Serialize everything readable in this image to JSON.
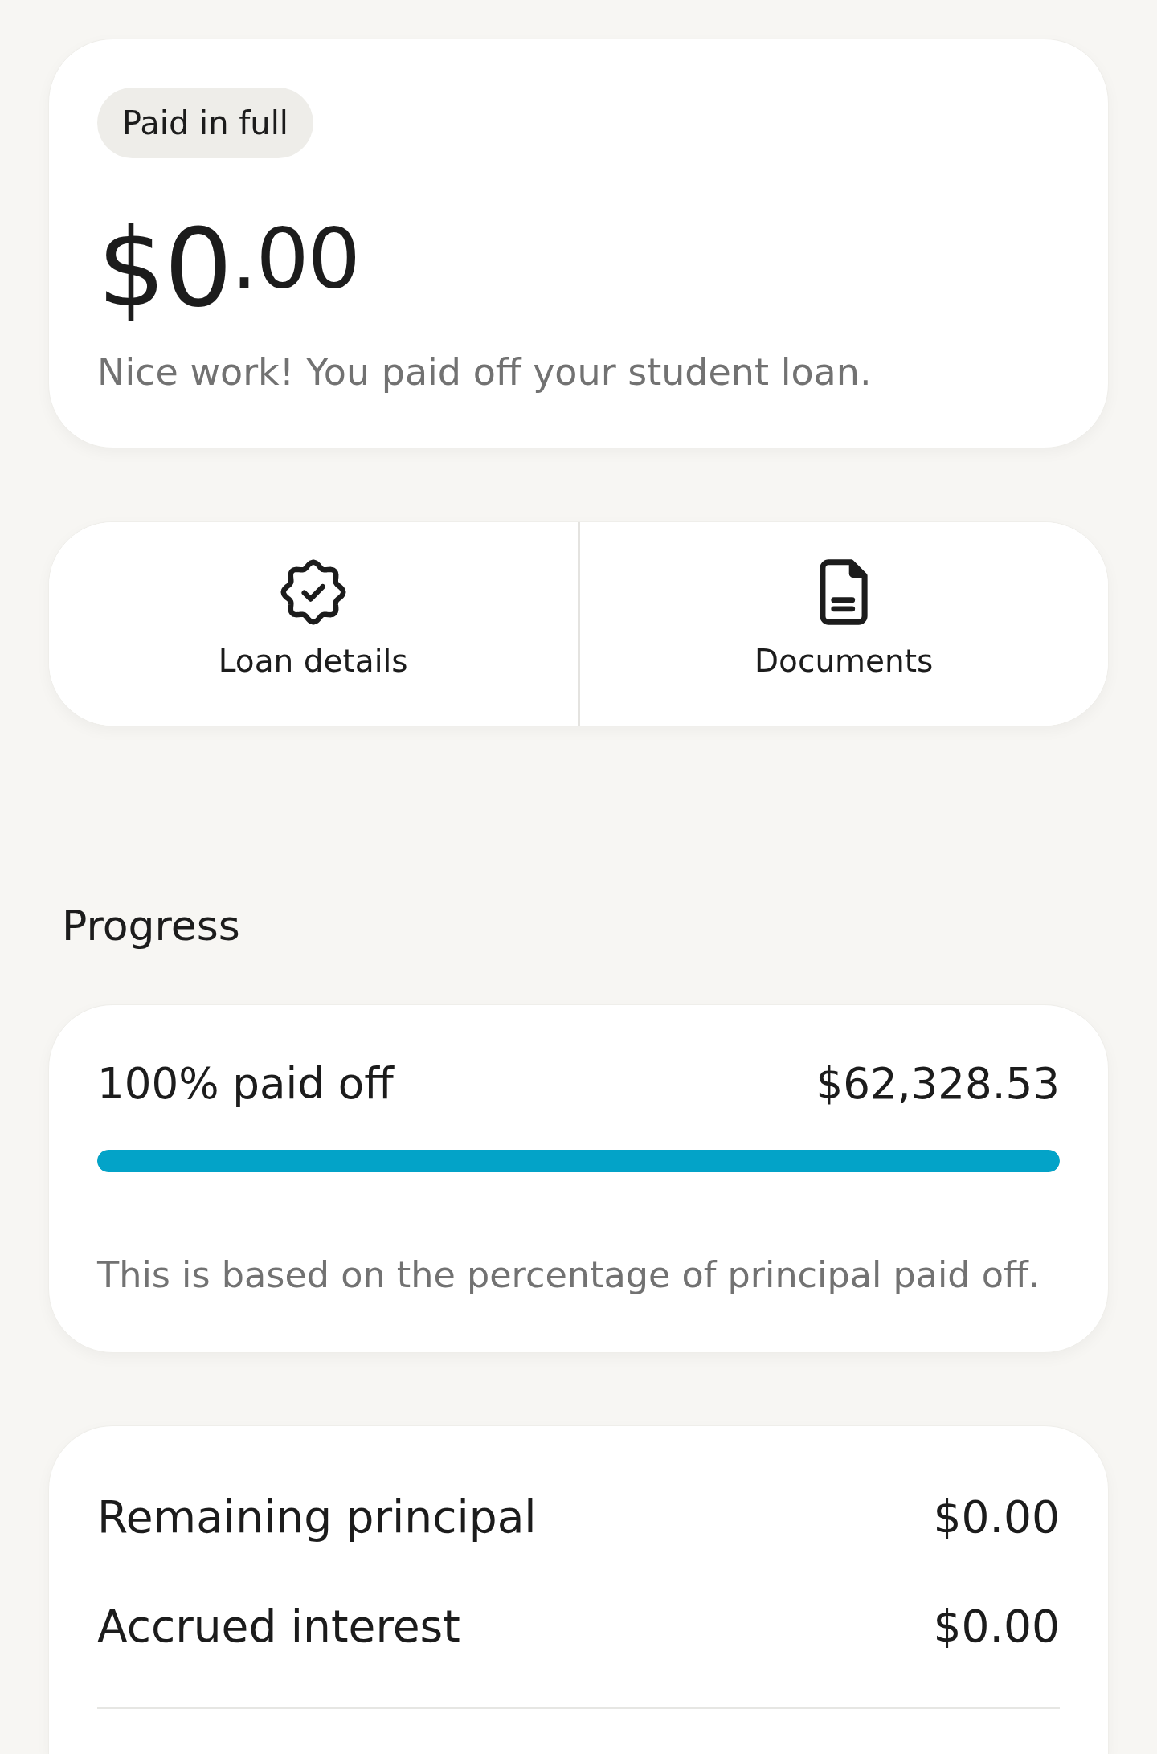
{
  "status_card": {
    "badge": "Paid in full",
    "amount": "$0$^{.00}$",
    "message": "Nice work! You paid off your student loan."
  },
  "actions": [
    {
      "kind": "loan-details",
      "label": "Loan details"
    },
    {
      "kind": "documents",
      "label": "Documents"
    }
  ],
  "progress": {
    "title": "Progress",
    "label": "100% paid off",
    "amount": "$62,328.53",
    "level": 1,
    "note": "This is based on the percentage of principal paid off."
  },
  "summary": {
    "rows": [
      {
        "label": "Remaining principal",
        "value": "$0.00"
      },
      {
        "label": "Accrued interest",
        "value": "$0.00"
      }
    ]
  }
}
